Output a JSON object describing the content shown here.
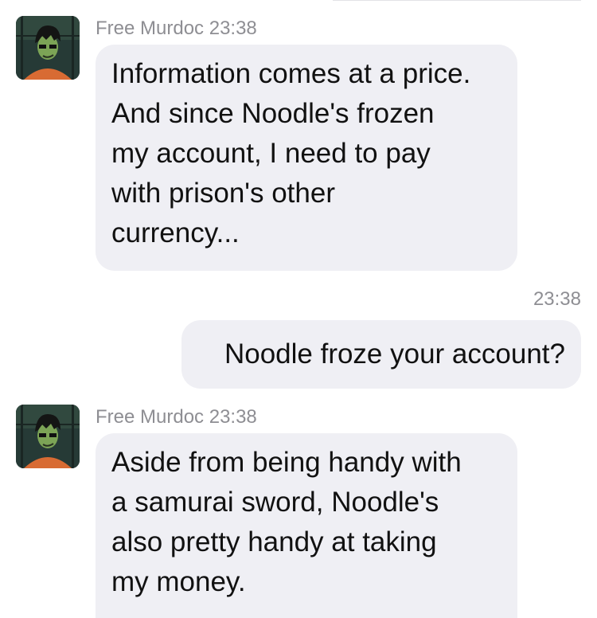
{
  "messages": [
    {
      "sender": "Free Murdoc",
      "time": "23:38",
      "lines": [
        "Information comes at a price.",
        "And since Noodle's frozen",
        "my account, I need to pay",
        "with prison's other",
        "currency..."
      ]
    },
    {
      "time": "23:38",
      "text": "Noodle froze your account?"
    },
    {
      "sender": "Free Murdoc",
      "time": "23:38",
      "lines": [
        "Aside from being handy with",
        "a samurai sword, Noodle's",
        "also pretty handy at taking",
        "my money."
      ]
    }
  ],
  "colors": {
    "incoming_bubble": "#efeff4",
    "outgoing_bubble": "#efeff4",
    "meta_text": "#8e8e93"
  },
  "icons": {
    "avatar": "contact-avatar-icon"
  }
}
